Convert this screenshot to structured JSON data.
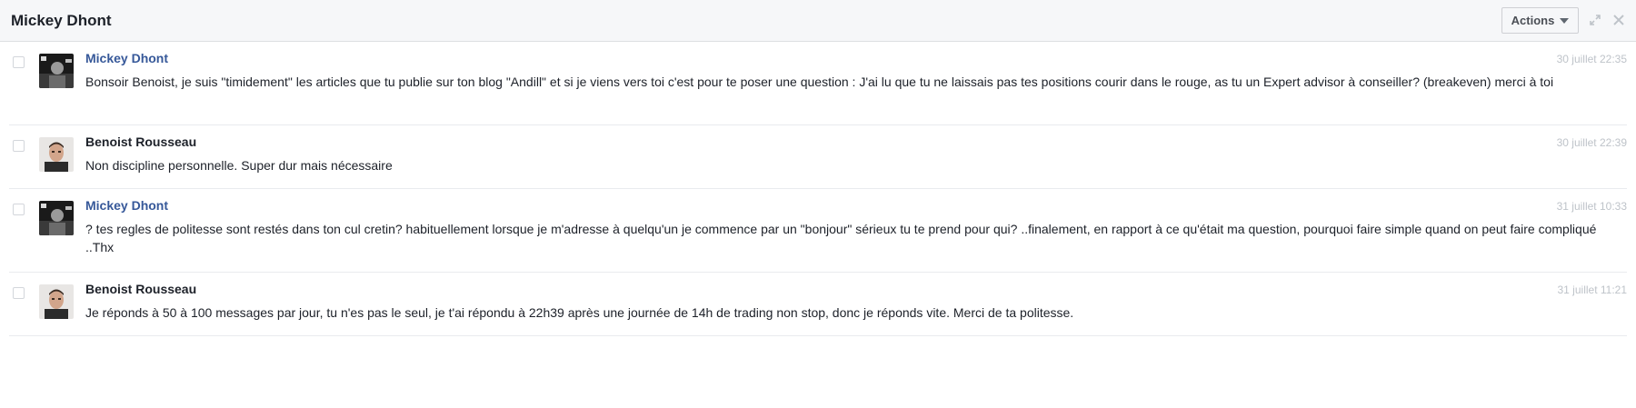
{
  "header": {
    "title": "Mickey Dhont",
    "actions_label": "Actions",
    "expand_icon": "expand-icon",
    "close_icon": "close-icon"
  },
  "messages": [
    {
      "author": "Mickey Dhont",
      "time": "30 juillet 22:35",
      "text": "Bonsoir Benoist, je suis \"timidement\" les articles que tu publie sur ton blog \"Andill\" et si je viens vers toi c'est pour te poser une question : J'ai lu que tu ne laissais pas tes positions courir dans le rouge, as tu un Expert advisor à conseiller? (breakeven) merci à toi"
    },
    {
      "author": "Benoist Rousseau",
      "time": "30 juillet 22:39",
      "text": "Non discipline personnelle. Super dur mais nécessaire"
    },
    {
      "author": "Mickey Dhont",
      "time": "31 juillet 10:33",
      "text": "? tes regles de politesse sont restés dans ton cul cretin? habituellement lorsque je m'adresse à quelqu'un je commence par un \"bonjour\" sérieux tu te prend pour qui? ..finalement, en rapport à ce qu'était ma question, pourquoi faire simple quand on peut faire compliqué ..Thx"
    },
    {
      "author": "Benoist Rousseau",
      "time": "31 juillet 11:21",
      "text": "Je réponds à 50 à 100 messages par jour, tu n'es pas le seul, je t'ai répondu à 22h39 après une journée de 14h de trading non stop, donc je réponds vite. Merci de ta politesse."
    }
  ]
}
